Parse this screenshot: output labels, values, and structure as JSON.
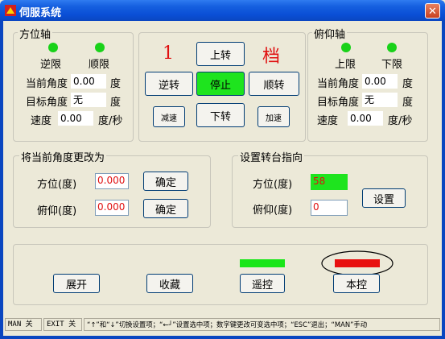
{
  "window": {
    "title": "伺服系统",
    "close_symbol": "✕"
  },
  "azimuth": {
    "legend": "方位轴",
    "limit_rev_label": "逆限",
    "limit_fwd_label": "顺限",
    "current_angle_label": "当前角度",
    "current_angle_value": "0.00",
    "current_angle_unit": "度",
    "target_angle_label": "目标角度",
    "target_angle_value": "无",
    "target_angle_unit": "度",
    "speed_label": "速度",
    "speed_value": "0.00",
    "speed_unit": "度/秒"
  },
  "control": {
    "gear_value": "1",
    "gear_label": "档",
    "up_label": "上转",
    "reverse_label": "逆转",
    "stop_label": "停止",
    "forward_label": "顺转",
    "slow_label": "减速",
    "down_label": "下转",
    "fast_label": "加速"
  },
  "pitch": {
    "legend": "俯仰轴",
    "limit_up_label": "上限",
    "limit_down_label": "下限",
    "current_angle_label": "当前角度",
    "current_angle_value": "0.00",
    "current_angle_unit": "度",
    "target_angle_label": "目标角度",
    "target_angle_value": "无",
    "target_angle_unit": "度",
    "speed_label": "速度",
    "speed_value": "0.00",
    "speed_unit": "度/秒"
  },
  "change_angle": {
    "legend": "将当前角度更改为",
    "azimuth_label": "方位(度)",
    "azimuth_value": "0.000",
    "azimuth_confirm": "确定",
    "pitch_label": "俯仰(度)",
    "pitch_value": "0.000",
    "pitch_confirm": "确定"
  },
  "turntable": {
    "legend": "设置转台指向",
    "azimuth_label": "方位(度)",
    "azimuth_value": "58",
    "pitch_label": "俯仰(度)",
    "pitch_value": "0",
    "set_label": "设置"
  },
  "bottom": {
    "expand_label": "展开",
    "collapse_label": "收藏",
    "remote_label": "遥控",
    "local_label": "本控",
    "remote_indicator_color": "#19e619",
    "local_indicator_color": "#e81010"
  },
  "statusbar": {
    "man": "MAN 关",
    "exit": "EXIT 关",
    "hint": "“↑”和“↓”切换设置项；“←┘”设置选中项；数字键更改可变选中项；“ESC”退出；“MAN”手动"
  }
}
